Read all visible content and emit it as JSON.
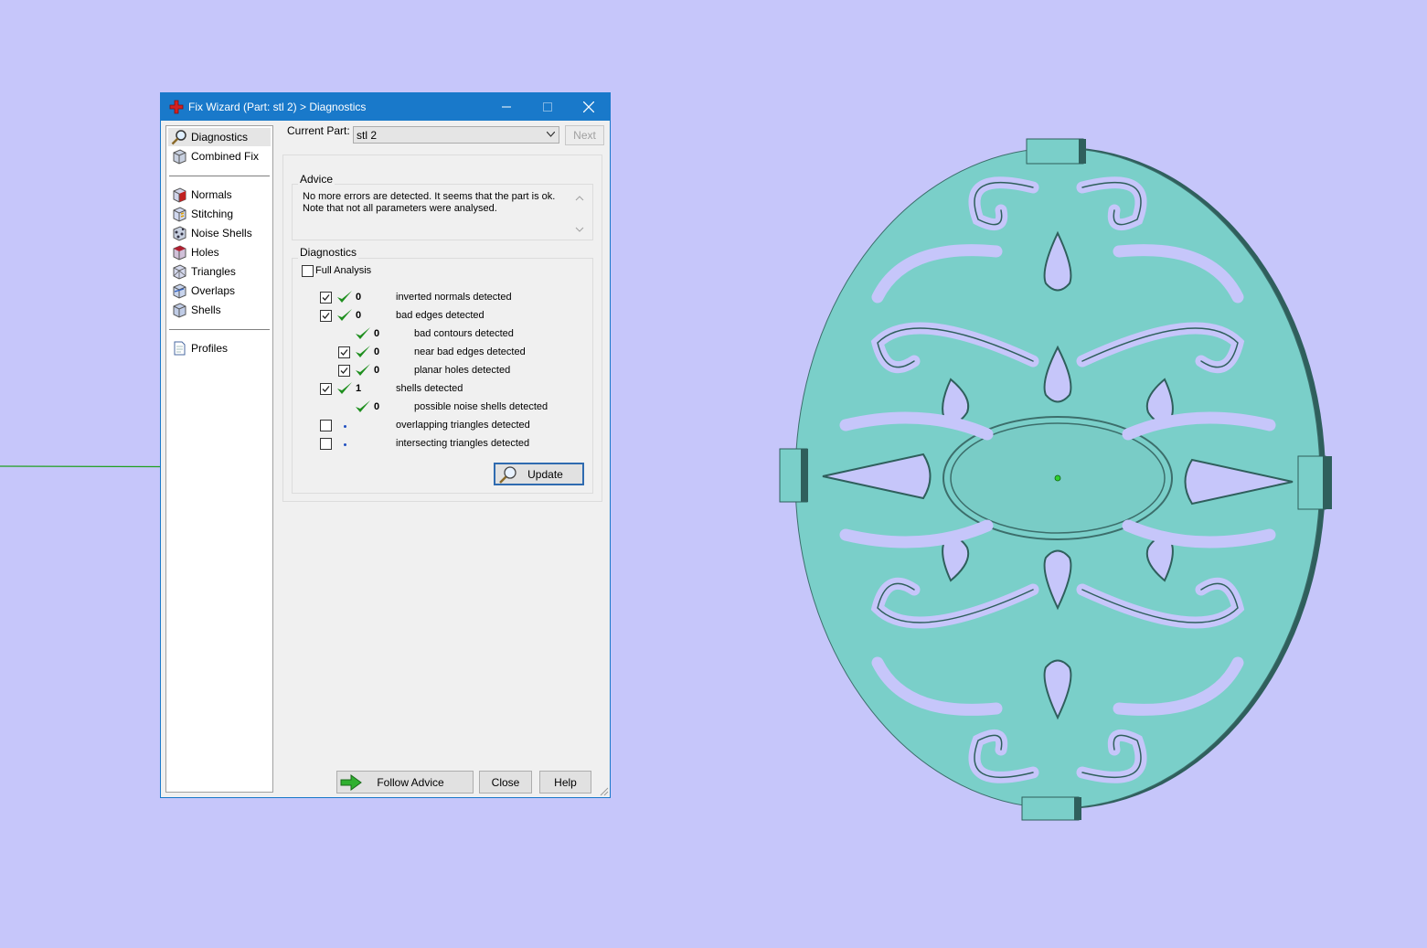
{
  "window": {
    "title": "Fix Wizard (Part: stl 2) > Diagnostics",
    "accent": "#1979ca"
  },
  "sidebar": {
    "items": [
      {
        "label": "Diagnostics",
        "icon": "magnifier-icon",
        "selected": true
      },
      {
        "label": "Combined Fix",
        "icon": "cube-icon"
      },
      {
        "label": "Normals",
        "icon": "normals-cube-icon"
      },
      {
        "label": "Stitching",
        "icon": "stitching-cube-icon"
      },
      {
        "label": "Noise Shells",
        "icon": "noise-shells-icon"
      },
      {
        "label": "Holes",
        "icon": "holes-cube-icon"
      },
      {
        "label": "Triangles",
        "icon": "triangles-cube-icon"
      },
      {
        "label": "Overlaps",
        "icon": "overlaps-cube-icon"
      },
      {
        "label": "Shells",
        "icon": "shells-cube-icon"
      },
      {
        "label": "Profiles",
        "icon": "document-icon"
      }
    ]
  },
  "current_part": {
    "label": "Current Part:",
    "value": "stl 2",
    "next_label": "Next"
  },
  "advice": {
    "title": "Advice",
    "text_line1": "No more errors are detected. It seems that the part is ok.",
    "text_line2": "Note that not all parameters were analysed."
  },
  "diagnostics": {
    "title": "Diagnostics",
    "full_analysis_label": "Full Analysis",
    "full_analysis_checked": false,
    "rows": [
      {
        "checkbox": true,
        "checked": true,
        "status": "ok",
        "count": "0",
        "label": "inverted normals detected",
        "indent": 0
      },
      {
        "checkbox": true,
        "checked": true,
        "status": "ok",
        "count": "0",
        "label": "bad edges detected",
        "indent": 0
      },
      {
        "checkbox": false,
        "checked": false,
        "status": "ok",
        "count": "0",
        "label": "bad contours detected",
        "indent": 1
      },
      {
        "checkbox": true,
        "checked": true,
        "status": "ok",
        "count": "0",
        "label": "near bad edges detected",
        "indent": 1
      },
      {
        "checkbox": true,
        "checked": true,
        "status": "ok",
        "count": "0",
        "label": "planar holes detected",
        "indent": 1
      },
      {
        "checkbox": true,
        "checked": true,
        "status": "ok",
        "count": "1",
        "label": "shells detected",
        "indent": 0
      },
      {
        "checkbox": false,
        "checked": false,
        "status": "ok",
        "count": "0",
        "label": "possible noise shells detected",
        "indent": 1
      },
      {
        "checkbox": true,
        "checked": false,
        "status": "pending",
        "count": "",
        "label": "overlapping triangles detected",
        "indent": 0
      },
      {
        "checkbox": true,
        "checked": false,
        "status": "pending",
        "count": "",
        "label": "intersecting triangles detected",
        "indent": 0
      }
    ],
    "update_label": "Update"
  },
  "footer": {
    "follow_advice_label": "Follow Advice",
    "close_label": "Close",
    "help_label": "Help"
  },
  "colors": {
    "viewport_bg": "#c6c6fa",
    "part_fill": "#7acfc9",
    "check_green": "#1f8f1f"
  }
}
